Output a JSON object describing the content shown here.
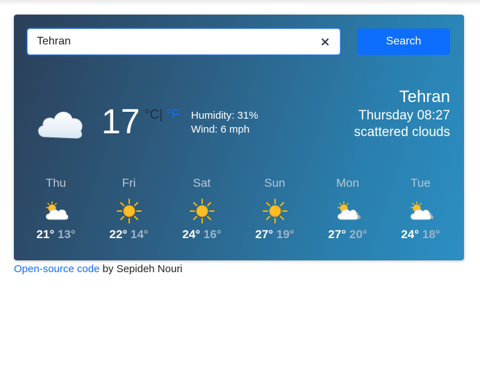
{
  "search": {
    "value": "Tehran",
    "clear_glyph": "×",
    "button_label": "Search"
  },
  "current": {
    "icon": "cloud-icon",
    "temperature": "17",
    "unit_celsius": "°C",
    "unit_separator": "|",
    "unit_fahrenheit": "°F",
    "humidity": "Humidity: 31%",
    "wind": "Wind: 6 mph",
    "city": "Tehran",
    "datetime": "Thursday 08:27",
    "description": "scattered clouds"
  },
  "forecast": [
    {
      "day": "Thu",
      "icon": "sun-behind-cloud-icon",
      "high": "21°",
      "low": "13°"
    },
    {
      "day": "Fri",
      "icon": "sun-icon",
      "high": "22°",
      "low": "14°"
    },
    {
      "day": "Sat",
      "icon": "sun-icon",
      "high": "24°",
      "low": "16°"
    },
    {
      "day": "Sun",
      "icon": "sun-icon",
      "high": "27°",
      "low": "19°"
    },
    {
      "day": "Mon",
      "icon": "sun-behind-cloud-icon",
      "high": "27°",
      "low": "20°"
    },
    {
      "day": "Tue",
      "icon": "sun-behind-cloud-icon",
      "high": "24°",
      "low": "18°"
    }
  ],
  "footer": {
    "link_text": "Open-source code",
    "suffix": " by Sepideh Nouri"
  },
  "colors": {
    "accent": "#0d6efd",
    "card_gradient_start": "#2b3f58",
    "card_gradient_end": "#2c8fc3"
  }
}
